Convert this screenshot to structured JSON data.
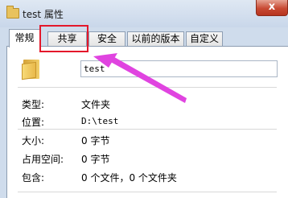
{
  "window": {
    "title": "test 属性",
    "close_symbol": "x"
  },
  "tabs": [
    {
      "label": "常规",
      "active": true
    },
    {
      "label": "共享",
      "active": false
    },
    {
      "label": "安全",
      "active": false
    },
    {
      "label": "以前的版本",
      "active": false
    },
    {
      "label": "自定义",
      "active": false
    }
  ],
  "general": {
    "name_value": "test",
    "icon": "folder-icon",
    "properties": [
      {
        "label": "类型:",
        "value": "文件夹"
      },
      {
        "label": "位置:",
        "value": "D:\\test"
      },
      {
        "label": "大小:",
        "value": "0 字节"
      },
      {
        "label": "占用空间:",
        "value": "0 字节"
      },
      {
        "label": "包含:",
        "value": "0 个文件，0 个文件夹"
      }
    ]
  },
  "annotation": {
    "highlight_color": "#e4182b",
    "arrow_color": "#e044e0"
  }
}
